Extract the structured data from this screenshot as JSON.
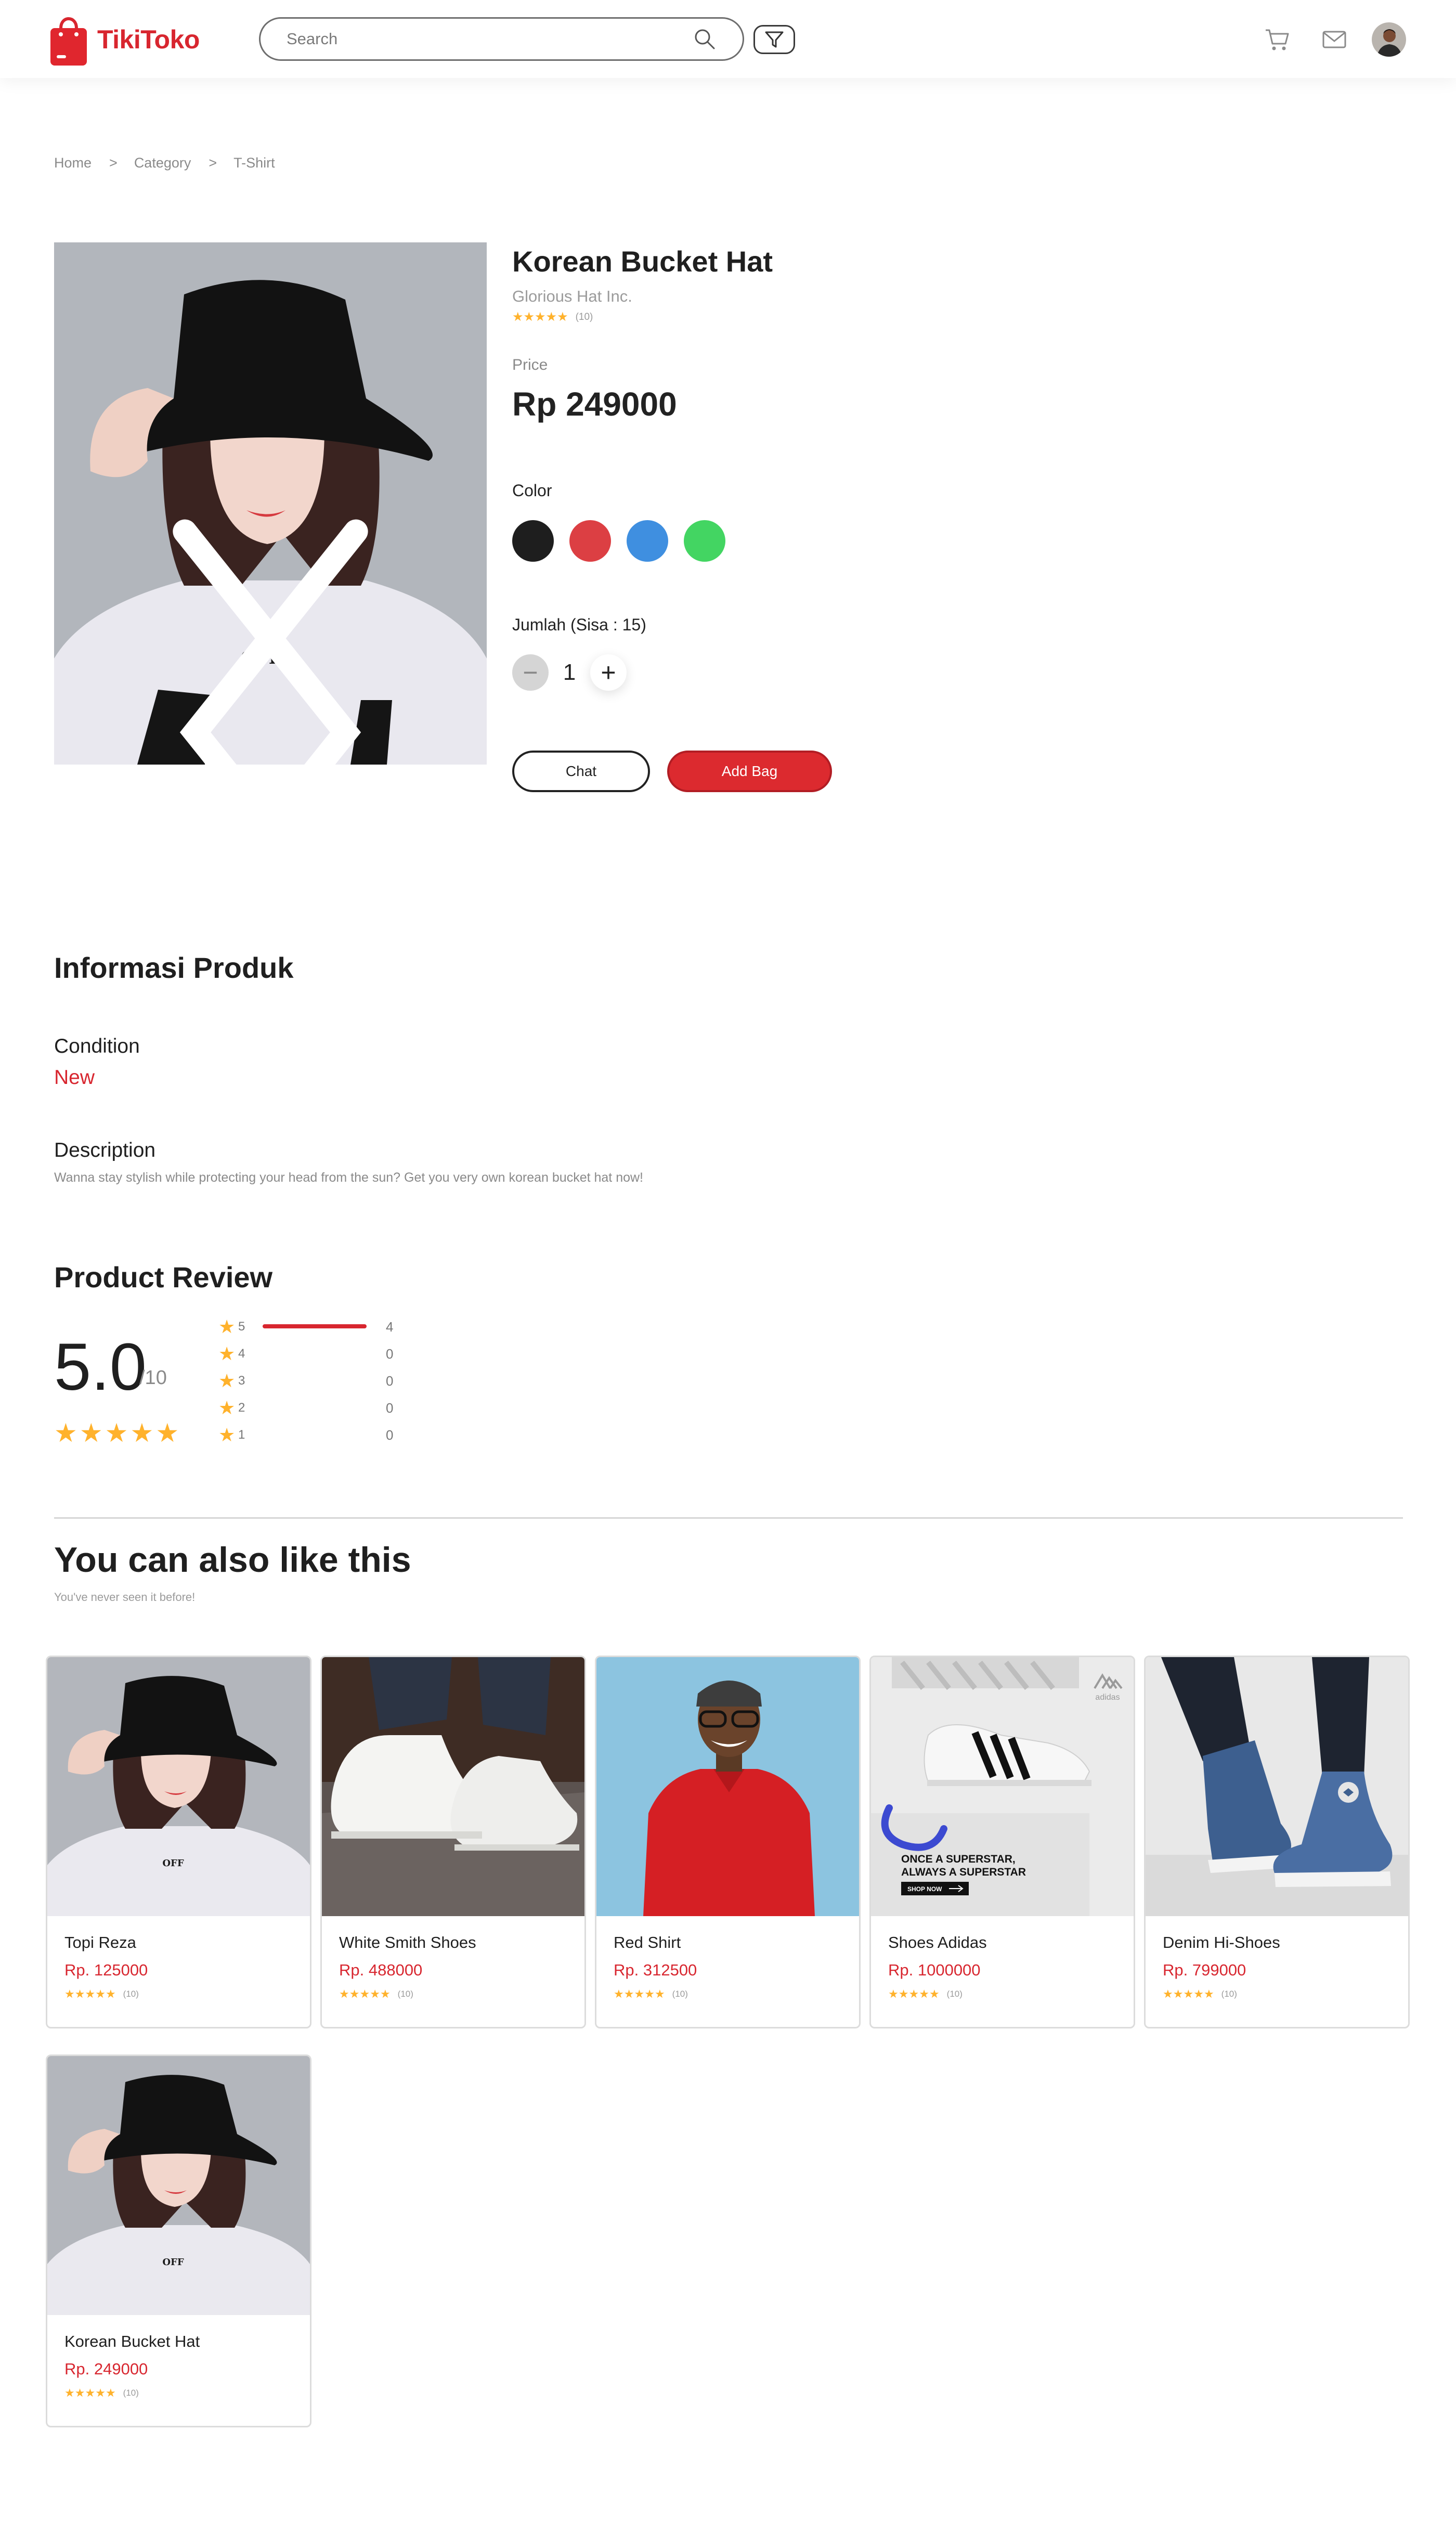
{
  "header": {
    "logo_text": "TikiToko",
    "search_placeholder": "Search"
  },
  "breadcrumb": [
    "Home",
    "Category",
    "T-Shirt"
  ],
  "breadcrumb_sep": ">",
  "product": {
    "title": "Korean Bucket Hat",
    "brand": "Glorious Hat Inc.",
    "rating_stars": 5,
    "rating_count": "(10)",
    "price_label": "Price",
    "price": "Rp 249000",
    "color_label": "Color",
    "colors": [
      "#1e1e1e",
      "#dc3f43",
      "#3f8fe0",
      "#43d562"
    ],
    "qty_label": "Jumlah (Sisa : 15)",
    "qty_minus": "−",
    "qty_value": "1",
    "qty_plus": "+",
    "chat_label": "Chat",
    "add_bag_label": "Add Bag"
  },
  "info": {
    "title": "Informasi Produk",
    "condition_label": "Condition",
    "condition_value": "New",
    "description_label": "Description",
    "description_value": "Wanna stay stylish while protecting your head from the sun? Get you very own korean bucket hat now!"
  },
  "review": {
    "title": "Product Review",
    "score": "5.0",
    "score_den": "/10",
    "stars": 5,
    "breakdown": [
      {
        "star": "5",
        "count": "4",
        "fraction": 1.0
      },
      {
        "star": "4",
        "count": "0",
        "fraction": 0
      },
      {
        "star": "3",
        "count": "0",
        "fraction": 0
      },
      {
        "star": "2",
        "count": "0",
        "fraction": 0
      },
      {
        "star": "1",
        "count": "0",
        "fraction": 0
      }
    ]
  },
  "recommend": {
    "title": "You can also like this",
    "subtitle": "You've never seen it before!",
    "items": [
      {
        "name": "Topi Reza",
        "price": "Rp. 125000",
        "rating_count": "(10)",
        "image": "bucket-hat"
      },
      {
        "name": "White Smith Shoes",
        "price": "Rp. 488000",
        "rating_count": "(10)",
        "image": "white-shoes"
      },
      {
        "name": "Red Shirt",
        "price": "Rp. 312500",
        "rating_count": "(10)",
        "image": "red-shirt"
      },
      {
        "name": "Shoes Adidas",
        "price": "Rp. 1000000",
        "rating_count": "(10)",
        "image": "adidas-ad",
        "ad_line1": "ONCE A SUPERSTAR,",
        "ad_line2": "ALWAYS A SUPERSTAR",
        "ad_button": "SHOP NOW",
        "ad_brand": "adidas"
      },
      {
        "name": "Denim Hi-Shoes",
        "price": "Rp. 799000",
        "rating_count": "(10)",
        "image": "denim-shoes"
      },
      {
        "name": "Korean Bucket Hat",
        "price": "Rp. 249000",
        "rating_count": "(10)",
        "image": "bucket-hat"
      }
    ]
  },
  "image_text": {
    "shirt_print": "OFF"
  },
  "colors": {
    "brand_red": "#d8262f",
    "star": "#ffb22c"
  }
}
